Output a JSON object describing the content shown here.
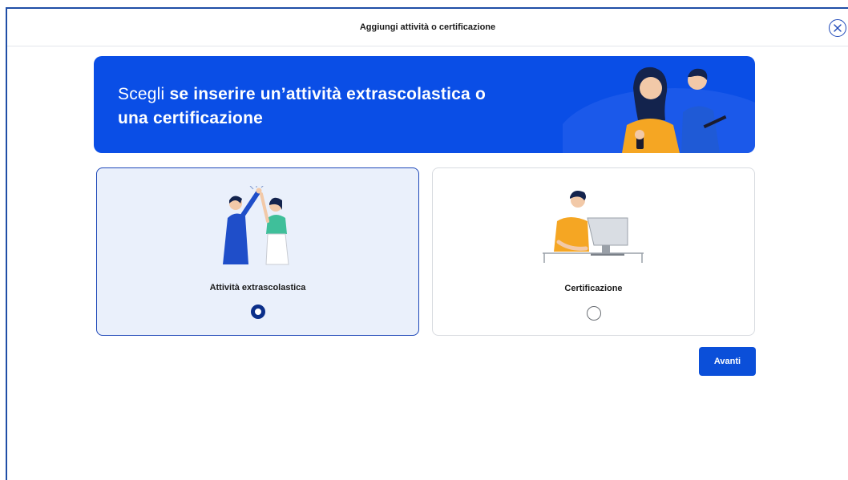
{
  "modal": {
    "title": "Aggiungi attività o certificazione",
    "close_icon": "close-circle-icon"
  },
  "banner": {
    "text_plain": "Scegli ",
    "text_bold": "se inserire un’attività extrascolastica o una certificazione",
    "illustration": "students-illustration"
  },
  "options": [
    {
      "label": "Attività extrascolastica",
      "selected": true,
      "illustration": "high-five-illustration"
    },
    {
      "label": "Certificazione",
      "selected": false,
      "illustration": "computer-user-illustration"
    }
  ],
  "actions": {
    "next_label": "Avanti"
  },
  "colors": {
    "primary": "#0b4fd9",
    "banner": "#0a4ee6",
    "selected_bg": "#eaf0fb",
    "accent_yellow": "#f5a623"
  }
}
